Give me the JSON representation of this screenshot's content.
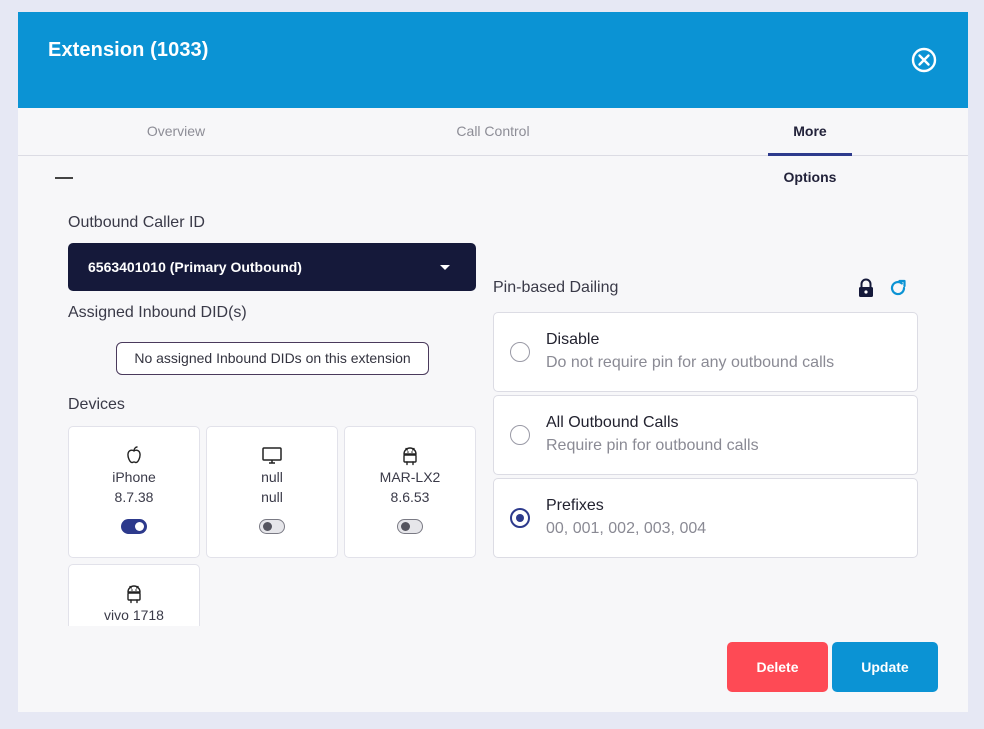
{
  "header": {
    "title": "Extension (1033)",
    "close_icon": "close-circle-icon"
  },
  "tabs": [
    {
      "label": "Overview",
      "active": false
    },
    {
      "label": "Call Control",
      "active": false
    },
    {
      "label": "More Options",
      "active": true
    }
  ],
  "outbound": {
    "label": "Outbound Caller ID",
    "value": "6563401010 (Primary Outbound)"
  },
  "inbound": {
    "label": "Assigned Inbound DID(s)",
    "empty_text": "No assigned Inbound DIDs on this extension"
  },
  "devices": {
    "label": "Devices",
    "items": [
      {
        "icon": "apple-icon",
        "name": "iPhone",
        "version": "8.7.38",
        "enabled": true
      },
      {
        "icon": "desktop-icon",
        "name": "null",
        "version": "null",
        "enabled": false
      },
      {
        "icon": "android-icon",
        "name": "MAR-LX2",
        "version": "8.6.53",
        "enabled": false
      },
      {
        "icon": "android-icon",
        "name": "vivo 1718",
        "version": "",
        "enabled": null
      }
    ]
  },
  "pin": {
    "label": "Pin-based Dailing",
    "lock_icon": "lock-icon",
    "refresh_icon": "refresh-icon",
    "options": [
      {
        "title": "Disable",
        "subtitle": "Do not require pin for any outbound calls",
        "selected": false
      },
      {
        "title": "All Outbound Calls",
        "subtitle": "Require pin for outbound calls",
        "selected": false
      },
      {
        "title": "Prefixes",
        "subtitle": "00, 001, 002, 003, 004",
        "selected": true
      }
    ]
  },
  "actions": {
    "delete_label": "Delete",
    "update_label": "Update"
  },
  "colors": {
    "header": "#0b93d4",
    "accent": "#2d3a8c",
    "danger": "#fe4a55",
    "select_bg": "#15193a"
  }
}
